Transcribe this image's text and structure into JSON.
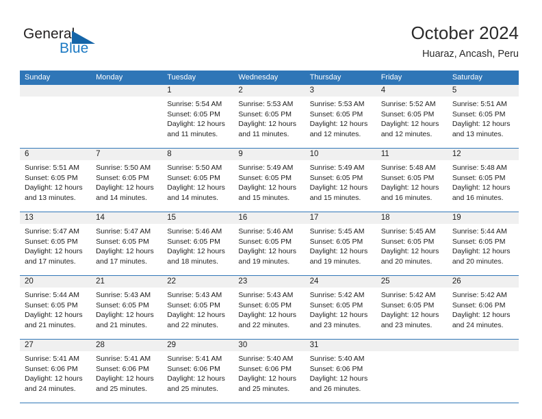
{
  "brand": {
    "name_part1": "General",
    "name_part2": "Blue",
    "triangle_icon": "triangle-icon",
    "accent_color": "#1b79c3"
  },
  "header": {
    "title": "October 2024",
    "subtitle": "Huaraz, Ancash, Peru"
  },
  "theme": {
    "header_blue": "#2f76b7",
    "daynum_band": "#f0f0f0",
    "text": "#1c1c1c"
  },
  "calendar": {
    "weekday_headers": [
      "Sunday",
      "Monday",
      "Tuesday",
      "Wednesday",
      "Thursday",
      "Friday",
      "Saturday"
    ],
    "weeks": [
      [
        {
          "day": "",
          "lines": []
        },
        {
          "day": "",
          "lines": []
        },
        {
          "day": "1",
          "lines": [
            "Sunrise: 5:54 AM",
            "Sunset: 6:05 PM",
            "Daylight: 12 hours",
            "and 11 minutes."
          ]
        },
        {
          "day": "2",
          "lines": [
            "Sunrise: 5:53 AM",
            "Sunset: 6:05 PM",
            "Daylight: 12 hours",
            "and 11 minutes."
          ]
        },
        {
          "day": "3",
          "lines": [
            "Sunrise: 5:53 AM",
            "Sunset: 6:05 PM",
            "Daylight: 12 hours",
            "and 12 minutes."
          ]
        },
        {
          "day": "4",
          "lines": [
            "Sunrise: 5:52 AM",
            "Sunset: 6:05 PM",
            "Daylight: 12 hours",
            "and 12 minutes."
          ]
        },
        {
          "day": "5",
          "lines": [
            "Sunrise: 5:51 AM",
            "Sunset: 6:05 PM",
            "Daylight: 12 hours",
            "and 13 minutes."
          ]
        }
      ],
      [
        {
          "day": "6",
          "lines": [
            "Sunrise: 5:51 AM",
            "Sunset: 6:05 PM",
            "Daylight: 12 hours",
            "and 13 minutes."
          ]
        },
        {
          "day": "7",
          "lines": [
            "Sunrise: 5:50 AM",
            "Sunset: 6:05 PM",
            "Daylight: 12 hours",
            "and 14 minutes."
          ]
        },
        {
          "day": "8",
          "lines": [
            "Sunrise: 5:50 AM",
            "Sunset: 6:05 PM",
            "Daylight: 12 hours",
            "and 14 minutes."
          ]
        },
        {
          "day": "9",
          "lines": [
            "Sunrise: 5:49 AM",
            "Sunset: 6:05 PM",
            "Daylight: 12 hours",
            "and 15 minutes."
          ]
        },
        {
          "day": "10",
          "lines": [
            "Sunrise: 5:49 AM",
            "Sunset: 6:05 PM",
            "Daylight: 12 hours",
            "and 15 minutes."
          ]
        },
        {
          "day": "11",
          "lines": [
            "Sunrise: 5:48 AM",
            "Sunset: 6:05 PM",
            "Daylight: 12 hours",
            "and 16 minutes."
          ]
        },
        {
          "day": "12",
          "lines": [
            "Sunrise: 5:48 AM",
            "Sunset: 6:05 PM",
            "Daylight: 12 hours",
            "and 16 minutes."
          ]
        }
      ],
      [
        {
          "day": "13",
          "lines": [
            "Sunrise: 5:47 AM",
            "Sunset: 6:05 PM",
            "Daylight: 12 hours",
            "and 17 minutes."
          ]
        },
        {
          "day": "14",
          "lines": [
            "Sunrise: 5:47 AM",
            "Sunset: 6:05 PM",
            "Daylight: 12 hours",
            "and 17 minutes."
          ]
        },
        {
          "day": "15",
          "lines": [
            "Sunrise: 5:46 AM",
            "Sunset: 6:05 PM",
            "Daylight: 12 hours",
            "and 18 minutes."
          ]
        },
        {
          "day": "16",
          "lines": [
            "Sunrise: 5:46 AM",
            "Sunset: 6:05 PM",
            "Daylight: 12 hours",
            "and 19 minutes."
          ]
        },
        {
          "day": "17",
          "lines": [
            "Sunrise: 5:45 AM",
            "Sunset: 6:05 PM",
            "Daylight: 12 hours",
            "and 19 minutes."
          ]
        },
        {
          "day": "18",
          "lines": [
            "Sunrise: 5:45 AM",
            "Sunset: 6:05 PM",
            "Daylight: 12 hours",
            "and 20 minutes."
          ]
        },
        {
          "day": "19",
          "lines": [
            "Sunrise: 5:44 AM",
            "Sunset: 6:05 PM",
            "Daylight: 12 hours",
            "and 20 minutes."
          ]
        }
      ],
      [
        {
          "day": "20",
          "lines": [
            "Sunrise: 5:44 AM",
            "Sunset: 6:05 PM",
            "Daylight: 12 hours",
            "and 21 minutes."
          ]
        },
        {
          "day": "21",
          "lines": [
            "Sunrise: 5:43 AM",
            "Sunset: 6:05 PM",
            "Daylight: 12 hours",
            "and 21 minutes."
          ]
        },
        {
          "day": "22",
          "lines": [
            "Sunrise: 5:43 AM",
            "Sunset: 6:05 PM",
            "Daylight: 12 hours",
            "and 22 minutes."
          ]
        },
        {
          "day": "23",
          "lines": [
            "Sunrise: 5:43 AM",
            "Sunset: 6:05 PM",
            "Daylight: 12 hours",
            "and 22 minutes."
          ]
        },
        {
          "day": "24",
          "lines": [
            "Sunrise: 5:42 AM",
            "Sunset: 6:05 PM",
            "Daylight: 12 hours",
            "and 23 minutes."
          ]
        },
        {
          "day": "25",
          "lines": [
            "Sunrise: 5:42 AM",
            "Sunset: 6:05 PM",
            "Daylight: 12 hours",
            "and 23 minutes."
          ]
        },
        {
          "day": "26",
          "lines": [
            "Sunrise: 5:42 AM",
            "Sunset: 6:06 PM",
            "Daylight: 12 hours",
            "and 24 minutes."
          ]
        }
      ],
      [
        {
          "day": "27",
          "lines": [
            "Sunrise: 5:41 AM",
            "Sunset: 6:06 PM",
            "Daylight: 12 hours",
            "and 24 minutes."
          ]
        },
        {
          "day": "28",
          "lines": [
            "Sunrise: 5:41 AM",
            "Sunset: 6:06 PM",
            "Daylight: 12 hours",
            "and 25 minutes."
          ]
        },
        {
          "day": "29",
          "lines": [
            "Sunrise: 5:41 AM",
            "Sunset: 6:06 PM",
            "Daylight: 12 hours",
            "and 25 minutes."
          ]
        },
        {
          "day": "30",
          "lines": [
            "Sunrise: 5:40 AM",
            "Sunset: 6:06 PM",
            "Daylight: 12 hours",
            "and 25 minutes."
          ]
        },
        {
          "day": "31",
          "lines": [
            "Sunrise: 5:40 AM",
            "Sunset: 6:06 PM",
            "Daylight: 12 hours",
            "and 26 minutes."
          ]
        },
        {
          "day": "",
          "lines": []
        },
        {
          "day": "",
          "lines": []
        }
      ]
    ]
  }
}
